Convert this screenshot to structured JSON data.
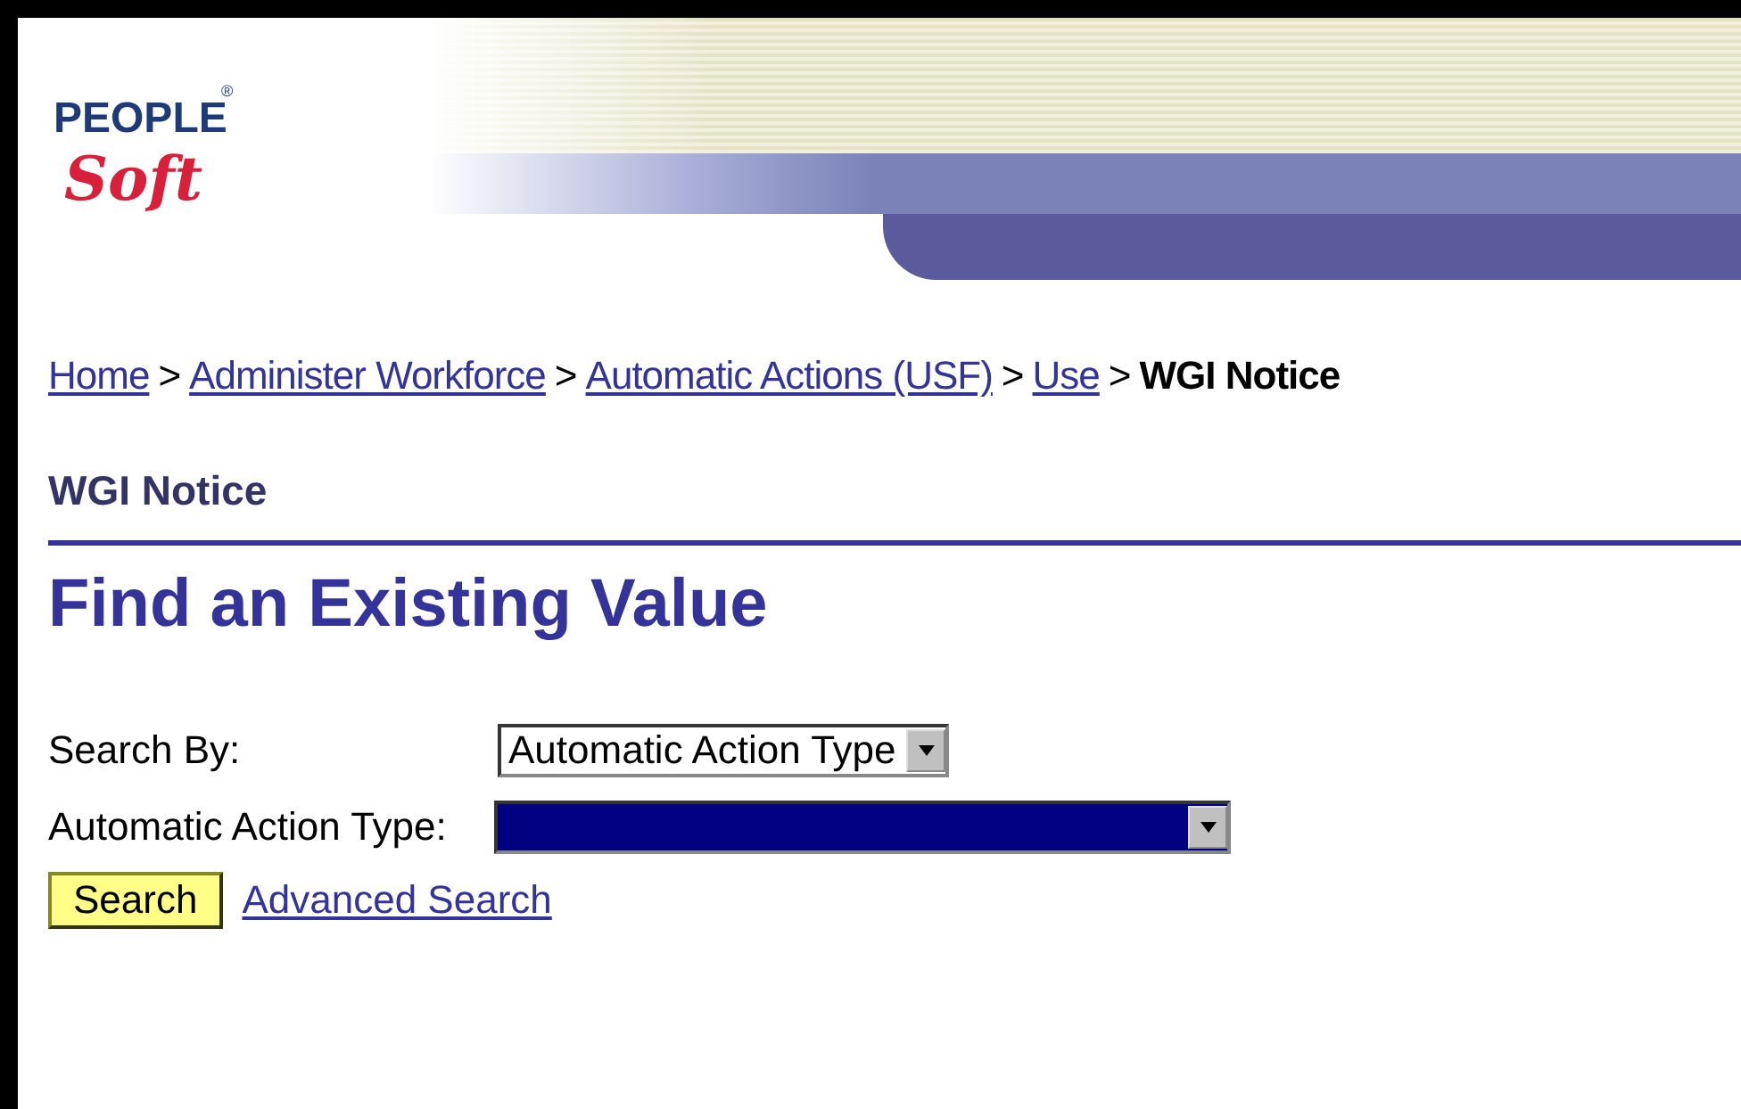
{
  "logo": {
    "line_1": "PEOPLE",
    "line_2": "Soft",
    "mark": "®"
  },
  "breadcrumb": [
    {
      "label": "Home",
      "kind": "link"
    },
    {
      "label": "Administer Workforce",
      "kind": "link"
    },
    {
      "label": "Automatic Actions (USF)",
      "kind": "link"
    },
    {
      "label": "Use",
      "kind": "link"
    },
    {
      "label": "WGI Notice",
      "kind": "current"
    }
  ],
  "breadcrumb_separator": ">",
  "page_title": "WGI Notice",
  "heading": "Find an Existing Value",
  "fields": [
    {
      "label": "Search By:",
      "value": "Automatic Action Type",
      "highlighted": false
    },
    {
      "label": "Automatic Action Type:",
      "highlighted": true
    }
  ],
  "search_button": "Search",
  "advanced_search_link": "Advanced Search"
}
